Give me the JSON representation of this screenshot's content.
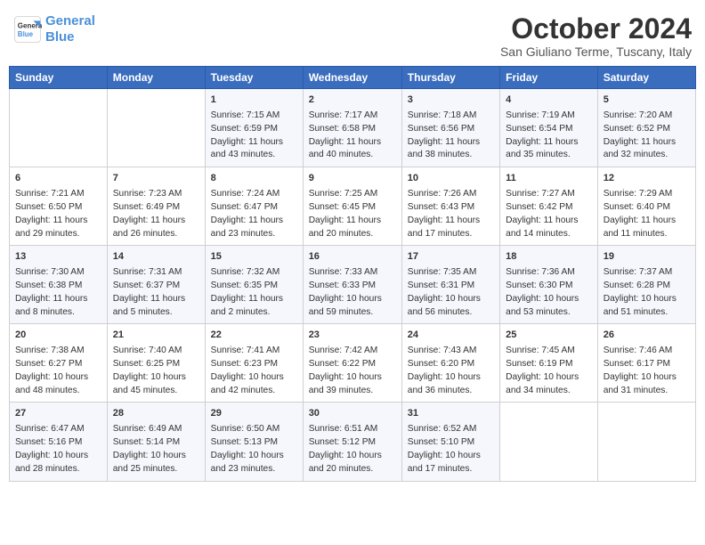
{
  "logo": {
    "line1": "General",
    "line2": "Blue"
  },
  "title": "October 2024",
  "location": "San Giuliano Terme, Tuscany, Italy",
  "days_header": [
    "Sunday",
    "Monday",
    "Tuesday",
    "Wednesday",
    "Thursday",
    "Friday",
    "Saturday"
  ],
  "weeks": [
    [
      {
        "day": "",
        "info": ""
      },
      {
        "day": "",
        "info": ""
      },
      {
        "day": "1",
        "info": "Sunrise: 7:15 AM\nSunset: 6:59 PM\nDaylight: 11 hours and 43 minutes."
      },
      {
        "day": "2",
        "info": "Sunrise: 7:17 AM\nSunset: 6:58 PM\nDaylight: 11 hours and 40 minutes."
      },
      {
        "day": "3",
        "info": "Sunrise: 7:18 AM\nSunset: 6:56 PM\nDaylight: 11 hours and 38 minutes."
      },
      {
        "day": "4",
        "info": "Sunrise: 7:19 AM\nSunset: 6:54 PM\nDaylight: 11 hours and 35 minutes."
      },
      {
        "day": "5",
        "info": "Sunrise: 7:20 AM\nSunset: 6:52 PM\nDaylight: 11 hours and 32 minutes."
      }
    ],
    [
      {
        "day": "6",
        "info": "Sunrise: 7:21 AM\nSunset: 6:50 PM\nDaylight: 11 hours and 29 minutes."
      },
      {
        "day": "7",
        "info": "Sunrise: 7:23 AM\nSunset: 6:49 PM\nDaylight: 11 hours and 26 minutes."
      },
      {
        "day": "8",
        "info": "Sunrise: 7:24 AM\nSunset: 6:47 PM\nDaylight: 11 hours and 23 minutes."
      },
      {
        "day": "9",
        "info": "Sunrise: 7:25 AM\nSunset: 6:45 PM\nDaylight: 11 hours and 20 minutes."
      },
      {
        "day": "10",
        "info": "Sunrise: 7:26 AM\nSunset: 6:43 PM\nDaylight: 11 hours and 17 minutes."
      },
      {
        "day": "11",
        "info": "Sunrise: 7:27 AM\nSunset: 6:42 PM\nDaylight: 11 hours and 14 minutes."
      },
      {
        "day": "12",
        "info": "Sunrise: 7:29 AM\nSunset: 6:40 PM\nDaylight: 11 hours and 11 minutes."
      }
    ],
    [
      {
        "day": "13",
        "info": "Sunrise: 7:30 AM\nSunset: 6:38 PM\nDaylight: 11 hours and 8 minutes."
      },
      {
        "day": "14",
        "info": "Sunrise: 7:31 AM\nSunset: 6:37 PM\nDaylight: 11 hours and 5 minutes."
      },
      {
        "day": "15",
        "info": "Sunrise: 7:32 AM\nSunset: 6:35 PM\nDaylight: 11 hours and 2 minutes."
      },
      {
        "day": "16",
        "info": "Sunrise: 7:33 AM\nSunset: 6:33 PM\nDaylight: 10 hours and 59 minutes."
      },
      {
        "day": "17",
        "info": "Sunrise: 7:35 AM\nSunset: 6:31 PM\nDaylight: 10 hours and 56 minutes."
      },
      {
        "day": "18",
        "info": "Sunrise: 7:36 AM\nSunset: 6:30 PM\nDaylight: 10 hours and 53 minutes."
      },
      {
        "day": "19",
        "info": "Sunrise: 7:37 AM\nSunset: 6:28 PM\nDaylight: 10 hours and 51 minutes."
      }
    ],
    [
      {
        "day": "20",
        "info": "Sunrise: 7:38 AM\nSunset: 6:27 PM\nDaylight: 10 hours and 48 minutes."
      },
      {
        "day": "21",
        "info": "Sunrise: 7:40 AM\nSunset: 6:25 PM\nDaylight: 10 hours and 45 minutes."
      },
      {
        "day": "22",
        "info": "Sunrise: 7:41 AM\nSunset: 6:23 PM\nDaylight: 10 hours and 42 minutes."
      },
      {
        "day": "23",
        "info": "Sunrise: 7:42 AM\nSunset: 6:22 PM\nDaylight: 10 hours and 39 minutes."
      },
      {
        "day": "24",
        "info": "Sunrise: 7:43 AM\nSunset: 6:20 PM\nDaylight: 10 hours and 36 minutes."
      },
      {
        "day": "25",
        "info": "Sunrise: 7:45 AM\nSunset: 6:19 PM\nDaylight: 10 hours and 34 minutes."
      },
      {
        "day": "26",
        "info": "Sunrise: 7:46 AM\nSunset: 6:17 PM\nDaylight: 10 hours and 31 minutes."
      }
    ],
    [
      {
        "day": "27",
        "info": "Sunrise: 6:47 AM\nSunset: 5:16 PM\nDaylight: 10 hours and 28 minutes."
      },
      {
        "day": "28",
        "info": "Sunrise: 6:49 AM\nSunset: 5:14 PM\nDaylight: 10 hours and 25 minutes."
      },
      {
        "day": "29",
        "info": "Sunrise: 6:50 AM\nSunset: 5:13 PM\nDaylight: 10 hours and 23 minutes."
      },
      {
        "day": "30",
        "info": "Sunrise: 6:51 AM\nSunset: 5:12 PM\nDaylight: 10 hours and 20 minutes."
      },
      {
        "day": "31",
        "info": "Sunrise: 6:52 AM\nSunset: 5:10 PM\nDaylight: 10 hours and 17 minutes."
      },
      {
        "day": "",
        "info": ""
      },
      {
        "day": "",
        "info": ""
      }
    ]
  ]
}
